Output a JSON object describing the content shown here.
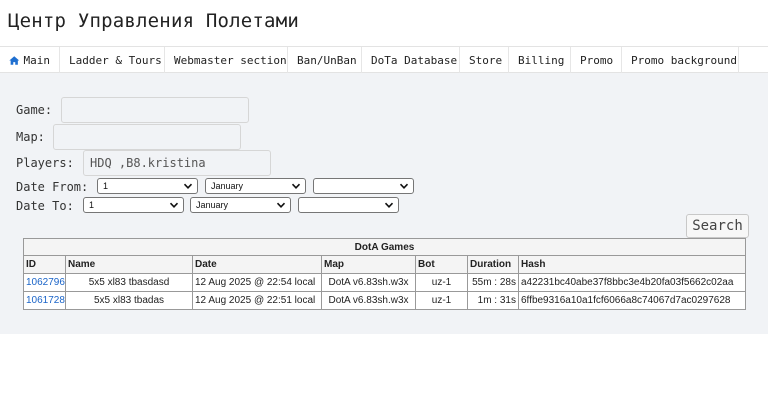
{
  "site": {
    "title": "Центр Управления Полетами"
  },
  "nav": [
    {
      "label": "Main",
      "icon": "home-icon"
    },
    {
      "label": "Ladder & Tours"
    },
    {
      "label": "Webmaster section"
    },
    {
      "label": "Ban/UnBan"
    },
    {
      "label": "DoTa Database"
    },
    {
      "label": "Store"
    },
    {
      "label": "Billing"
    },
    {
      "label": "Promo"
    },
    {
      "label": "Promo background"
    }
  ],
  "form": {
    "game_label": "Game:",
    "game_value": "",
    "map_label": "Map:",
    "map_value": "",
    "players_label": "Players:",
    "players_value": "HDQ ,B8.kristina",
    "date_from_label": "Date From:",
    "date_from": {
      "day": "1",
      "month": "January",
      "year": ""
    },
    "date_to_label": "Date To:",
    "date_to": {
      "day": "1",
      "month": "January",
      "year": ""
    },
    "search_label": "Search"
  },
  "table": {
    "caption": "DotA Games",
    "headers": [
      "ID",
      "Name",
      "Date",
      "Map",
      "Bot",
      "Duration",
      "Hash"
    ],
    "rows": [
      {
        "id": "1062796",
        "name": "5x5 xl83 tbasdasd",
        "date": "12 Aug 2025 @ 22:54 local",
        "map": "DotA v6.83sh.w3x",
        "bot": "uz-1",
        "duration": "55m : 28s",
        "hash": "a42231bc40abe37f8bbc3e4b20fa03f5662c02aa"
      },
      {
        "id": "1061728",
        "name": "5x5 xl83 tbadas",
        "date": "12 Aug 2025 @ 22:51 local",
        "map": "DotA v6.83sh.w3x",
        "bot": "uz-1",
        "duration": "1m : 31s",
        "hash": "6ffbe9316a10a1fcf6066a8c74067d7ac0297628"
      }
    ]
  },
  "colors": {
    "link": "#1a64c8",
    "home_icon": "#1f6fd0",
    "content_bg": "#f1f3f6"
  }
}
